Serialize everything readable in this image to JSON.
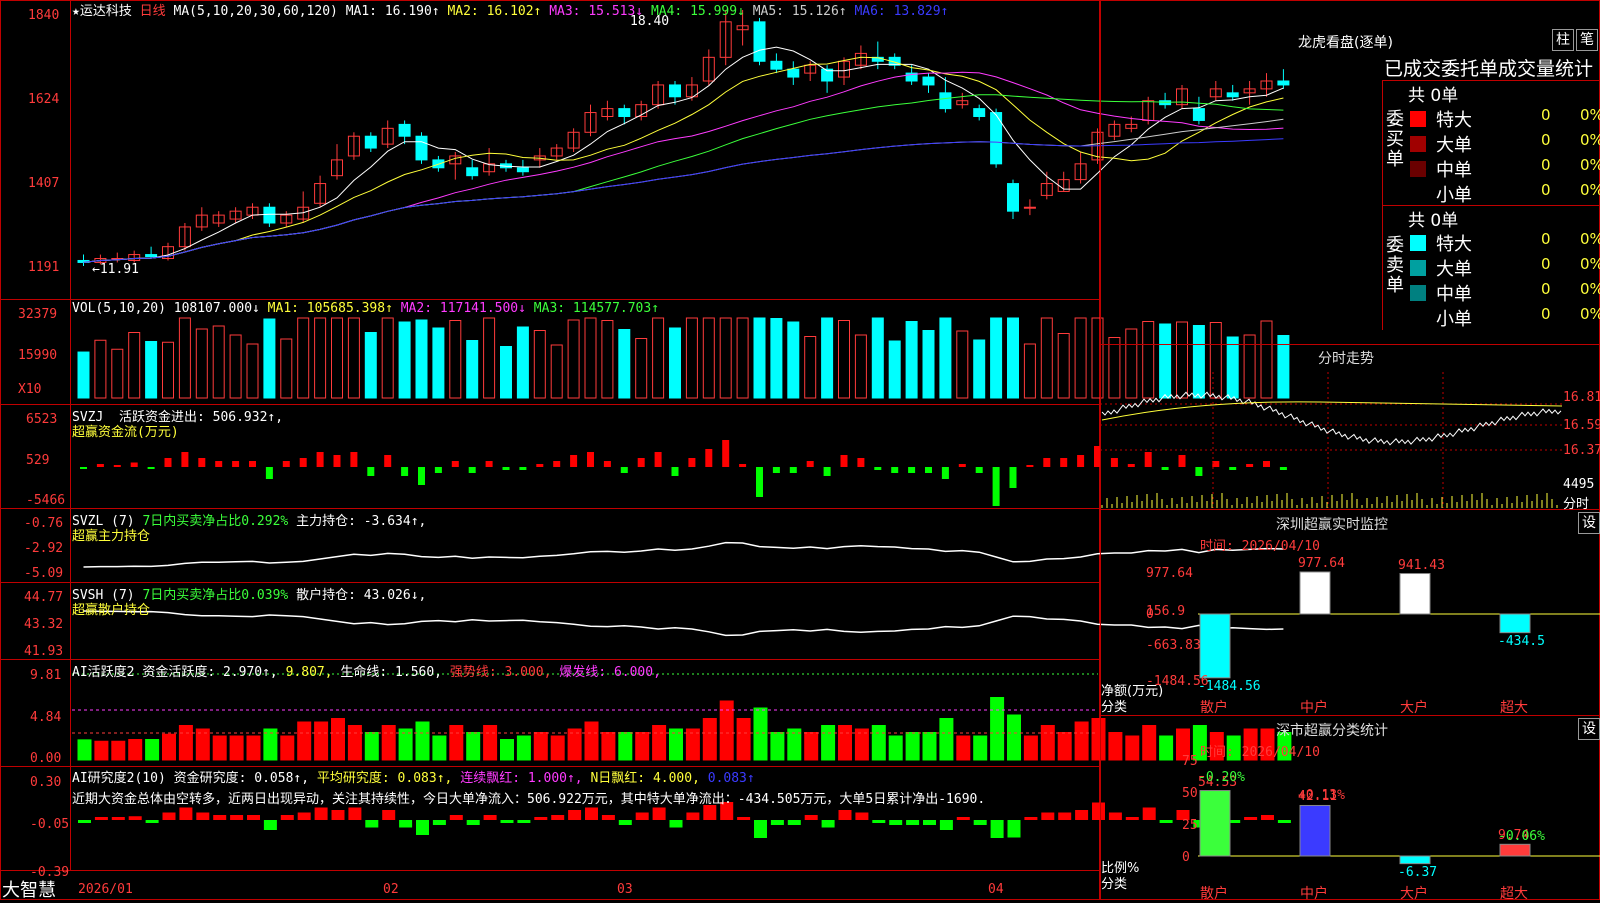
{
  "main": {
    "stock_name": "★运达科技",
    "period": "日线",
    "ma_label": "MA(5,10,20,30,60,120)",
    "ma_items": [
      {
        "text": "MA1: 16.190↑",
        "color": "#ffffff"
      },
      {
        "text": "MA2: 16.102↑",
        "color": "#ffff3b"
      },
      {
        "text": "MA3: 15.513↓",
        "color": "#ff3bff"
      },
      {
        "text": "MA4: 15.999↓",
        "color": "#3bff3b"
      },
      {
        "text": "MA5: 15.126↑",
        "color": "#cccccc"
      },
      {
        "text": "MA6: 13.829↑",
        "color": "#3b3bff"
      }
    ],
    "y_ticks": [
      "1840",
      "1624",
      "1407",
      "1191"
    ],
    "high_marker": "18.40",
    "low_marker": "←11.91",
    "candles": [
      [
        12.05,
        12.0,
        12.2,
        11.91
      ],
      [
        12.0,
        12.1,
        12.2,
        11.95
      ],
      [
        12.1,
        12.1,
        12.25,
        12.0
      ],
      [
        12.05,
        12.2,
        12.3,
        12.0
      ],
      [
        12.2,
        12.15,
        12.4,
        12.1
      ],
      [
        12.1,
        12.4,
        12.5,
        12.05
      ],
      [
        12.4,
        12.9,
        13.0,
        12.3
      ],
      [
        12.9,
        13.2,
        13.4,
        12.8
      ],
      [
        13.0,
        13.2,
        13.3,
        12.9
      ],
      [
        13.1,
        13.3,
        13.4,
        13.0
      ],
      [
        13.2,
        13.4,
        13.5,
        13.1
      ],
      [
        13.4,
        13.0,
        13.5,
        12.9
      ],
      [
        13.0,
        13.2,
        13.3,
        12.9
      ],
      [
        13.1,
        13.4,
        13.8,
        13.0
      ],
      [
        13.5,
        14.0,
        14.2,
        13.4
      ],
      [
        14.2,
        14.6,
        15.0,
        14.1
      ],
      [
        14.7,
        15.2,
        15.3,
        14.6
      ],
      [
        15.2,
        14.9,
        15.3,
        14.8
      ],
      [
        15.0,
        15.4,
        15.6,
        14.9
      ],
      [
        15.5,
        15.2,
        15.6,
        15.0
      ],
      [
        15.2,
        14.6,
        15.3,
        14.5
      ],
      [
        14.6,
        14.4,
        14.7,
        14.3
      ],
      [
        14.5,
        14.7,
        14.8,
        14.1
      ],
      [
        14.4,
        14.2,
        14.6,
        14.1
      ],
      [
        14.3,
        14.5,
        14.9,
        14.2
      ],
      [
        14.5,
        14.4,
        14.6,
        14.3
      ],
      [
        14.4,
        14.3,
        14.6,
        14.2
      ],
      [
        14.6,
        14.7,
        14.9,
        14.4
      ],
      [
        14.7,
        14.9,
        15.0,
        14.6
      ],
      [
        14.9,
        15.3,
        15.4,
        14.8
      ],
      [
        15.3,
        15.8,
        16.0,
        15.2
      ],
      [
        15.7,
        15.9,
        16.1,
        15.6
      ],
      [
        15.9,
        15.7,
        16.0,
        15.5
      ],
      [
        15.7,
        16.0,
        16.1,
        15.6
      ],
      [
        16.0,
        16.5,
        16.6,
        15.9
      ],
      [
        16.5,
        16.2,
        16.6,
        16.0
      ],
      [
        16.2,
        16.5,
        16.7,
        16.1
      ],
      [
        16.6,
        17.2,
        17.4,
        16.5
      ],
      [
        17.2,
        18.1,
        18.4,
        17.0
      ],
      [
        17.9,
        18.0,
        18.4,
        17.5
      ],
      [
        18.1,
        17.1,
        18.2,
        17.0
      ],
      [
        17.1,
        16.9,
        17.3,
        16.8
      ],
      [
        16.9,
        16.7,
        17.1,
        16.5
      ],
      [
        16.8,
        17.0,
        17.1,
        16.6
      ],
      [
        16.9,
        16.6,
        17.0,
        16.3
      ],
      [
        16.7,
        17.1,
        17.2,
        16.5
      ],
      [
        17.0,
        17.3,
        17.5,
        16.9
      ],
      [
        17.2,
        17.1,
        17.6,
        16.9
      ],
      [
        17.2,
        17.0,
        17.3,
        16.9
      ],
      [
        16.8,
        16.6,
        17.0,
        16.5
      ],
      [
        16.7,
        16.5,
        16.8,
        16.3
      ],
      [
        16.3,
        15.9,
        16.7,
        15.8
      ],
      [
        16.0,
        16.1,
        16.3,
        15.9
      ],
      [
        15.9,
        15.7,
        16.0,
        15.6
      ],
      [
        15.8,
        14.5,
        15.9,
        14.4
      ],
      [
        14.0,
        13.3,
        14.1,
        13.1
      ],
      [
        13.4,
        13.4,
        13.6,
        13.2
      ],
      [
        13.7,
        14.0,
        14.3,
        13.6
      ],
      [
        13.8,
        14.1,
        14.3,
        13.8
      ],
      [
        14.1,
        14.5,
        14.8,
        14.0
      ],
      [
        14.6,
        15.3,
        15.4,
        14.5
      ],
      [
        15.2,
        15.5,
        15.6,
        15.1
      ],
      [
        15.4,
        15.5,
        15.7,
        15.3
      ],
      [
        15.6,
        16.1,
        16.2,
        15.5
      ],
      [
        16.1,
        16.0,
        16.3,
        15.9
      ],
      [
        16.0,
        16.4,
        16.5,
        15.9
      ],
      [
        15.9,
        15.6,
        16.2,
        15.5
      ],
      [
        16.2,
        16.4,
        16.6,
        16.1
      ],
      [
        16.3,
        16.2,
        16.5,
        16.1
      ],
      [
        16.3,
        16.4,
        16.6,
        16.0
      ],
      [
        16.4,
        16.6,
        16.8,
        16.2
      ],
      [
        16.6,
        16.5,
        16.9,
        16.4
      ]
    ]
  },
  "vol": {
    "label": "VOL(5,10,20)",
    "items": [
      {
        "text": "108107.000↓",
        "color": "#ffffff"
      },
      {
        "text": "MA1: 105685.398↑",
        "color": "#ffff3b"
      },
      {
        "text": "MA2: 117141.500↓",
        "color": "#ff3bff"
      },
      {
        "text": "MA3: 114577.703↑",
        "color": "#3bff3b"
      }
    ],
    "y_ticks": [
      "32379",
      "15990",
      "X10"
    ]
  },
  "svzj": {
    "label": "SVZJ",
    "title": "活跃资金进出: 506.932↑,",
    "subtitle": "超赢资金流(万元)",
    "y_ticks": [
      "6523",
      "529",
      "-5466"
    ]
  },
  "svzl": {
    "label": "SVZL (7)",
    "ratio": "7日内买卖净占比0.292%",
    "hold": "主力持仓: -3.634↑,",
    "subtitle": "超赢主力持仓",
    "y_ticks": [
      "-0.76",
      "-2.92",
      "-5.09"
    ]
  },
  "svsh": {
    "label": "SVSH (7)",
    "ratio": "7日内买卖净占比0.039%",
    "hold": "散户持仓: 43.026↓,",
    "subtitle": "超赢散户持仓",
    "y_ticks": [
      "44.77",
      "43.32",
      "41.93"
    ]
  },
  "ai_active": {
    "label": "AI活跃度2",
    "items": [
      {
        "text": "资金活跃度: 2.970↑,",
        "color": "#ffffff"
      },
      {
        "text": "9.807,",
        "color": "#ffff3b"
      },
      {
        "text": "生命线: 1.560,",
        "color": "#ffffff"
      },
      {
        "text": "强势线: 3.000,",
        "color": "#ff3b3b"
      },
      {
        "text": "爆发线: 6.000,",
        "color": "#ff3bff"
      }
    ],
    "y_ticks": [
      "9.81",
      "4.84",
      "0.00"
    ]
  },
  "ai_research": {
    "label": "AI研究度2(10)",
    "items": [
      {
        "text": "资金研究度: 0.058↑,",
        "color": "#ffffff"
      },
      {
        "text": "平均研究度: 0.083↑,",
        "color": "#ffff3b"
      },
      {
        "text": "连续飘红: 1.000↑,",
        "color": "#ff3bff"
      },
      {
        "text": "N日飘红: 4.000,",
        "color": "#ffff3b"
      },
      {
        "text": "0.083↑",
        "color": "#3b3bff"
      }
    ],
    "comment": "近期大资金总体由空转多，近两日出现异动，关注其持续性，今日大单净流入：506.922万元，其中特大单净流出：-434.505万元，大单5日累计净出-1690.",
    "y_ticks": [
      "0.30",
      "-0.05",
      "-0.39"
    ]
  },
  "x_axis": {
    "labels": [
      {
        "text": "2026/01"
      },
      {
        "text": "02"
      },
      {
        "text": "03"
      },
      {
        "text": "04"
      }
    ]
  },
  "brand": "大智慧",
  "right": {
    "lhb": {
      "title": "龙虎看盘(逐单)",
      "btn_bar": "柱",
      "btn_pen": "笔",
      "tabs": [
        "已成交",
        "委托单",
        "成交量",
        "统计"
      ],
      "buy_label": "委买单",
      "sell_label": "委卖单",
      "buy_total": "共 0单",
      "sell_total": "共 0单",
      "rows_buy": [
        {
          "name": "特大",
          "count": "0",
          "pct": "0%",
          "color": "#ff0000"
        },
        {
          "name": "大单",
          "count": "0",
          "pct": "0%",
          "color": "#a00000"
        },
        {
          "name": "中单",
          "count": "0",
          "pct": "0%",
          "color": "#6a0000"
        },
        {
          "name": "小单",
          "count": "0",
          "pct": "0%",
          "color": "#000000"
        }
      ],
      "rows_sell": [
        {
          "name": "特大",
          "count": "0",
          "pct": "0%",
          "color": "#00ffff"
        },
        {
          "name": "大单",
          "count": "0",
          "pct": "0%",
          "color": "#00a0a0"
        },
        {
          "name": "中单",
          "count": "0",
          "pct": "0%",
          "color": "#008080"
        },
        {
          "name": "小单",
          "count": "0",
          "pct": "0%",
          "color": "#000000"
        }
      ]
    },
    "intraday": {
      "title": "分时走势",
      "y_ticks": [
        "16.81",
        "16.59",
        "16.37"
      ],
      "vol_tick": "4495",
      "vol_label": "分时"
    },
    "sz_monitor": {
      "title": "深圳超赢实时监控",
      "set_btn": "设",
      "time": "时间: 2026/04/10",
      "y_ticks": [
        "977.64",
        "156.9",
        "0",
        "-663.83",
        "-1484.56"
      ],
      "ylabel": "净额(万元)",
      "xlabel": "分类",
      "chart_data": {
        "type": "bar",
        "categories": [
          "散户",
          "中户",
          "大户",
          "超大"
        ],
        "values": [
          -1484.56,
          977.64,
          941.43,
          -434.5
        ],
        "value_labels": [
          "-1484.56",
          "977.64",
          "941.43",
          "-434.5"
        ],
        "ylim": [
          -1484.56,
          977.64
        ],
        "colors": [
          "#00ffff",
          "#ffffff",
          "#ffffff",
          "#00ffff"
        ]
      }
    },
    "sz_class": {
      "title": "深市超赢分类统计",
      "set_btn": "设",
      "time": "时间: 2026/04/10",
      "y_ticks": [
        "75",
        "50",
        "25",
        "0"
      ],
      "ylabel": "比例%",
      "xlabel": "分类",
      "chart_data": {
        "type": "bar",
        "categories": [
          "散户",
          "中户",
          "大户",
          "超大"
        ],
        "values": [
          54.53,
          42.11,
          -6.37,
          9.74
        ],
        "changes": [
          "-0.20%",
          "+0.13%",
          "",
          "-0.06%"
        ],
        "value_labels": [
          "54.53",
          "42.11",
          "-6.37",
          "9.74"
        ],
        "ylim": [
          0,
          75
        ],
        "colors": [
          "#3bff3b",
          "#3b3bff",
          "#00ffff",
          "#ff3b3b"
        ]
      }
    }
  }
}
